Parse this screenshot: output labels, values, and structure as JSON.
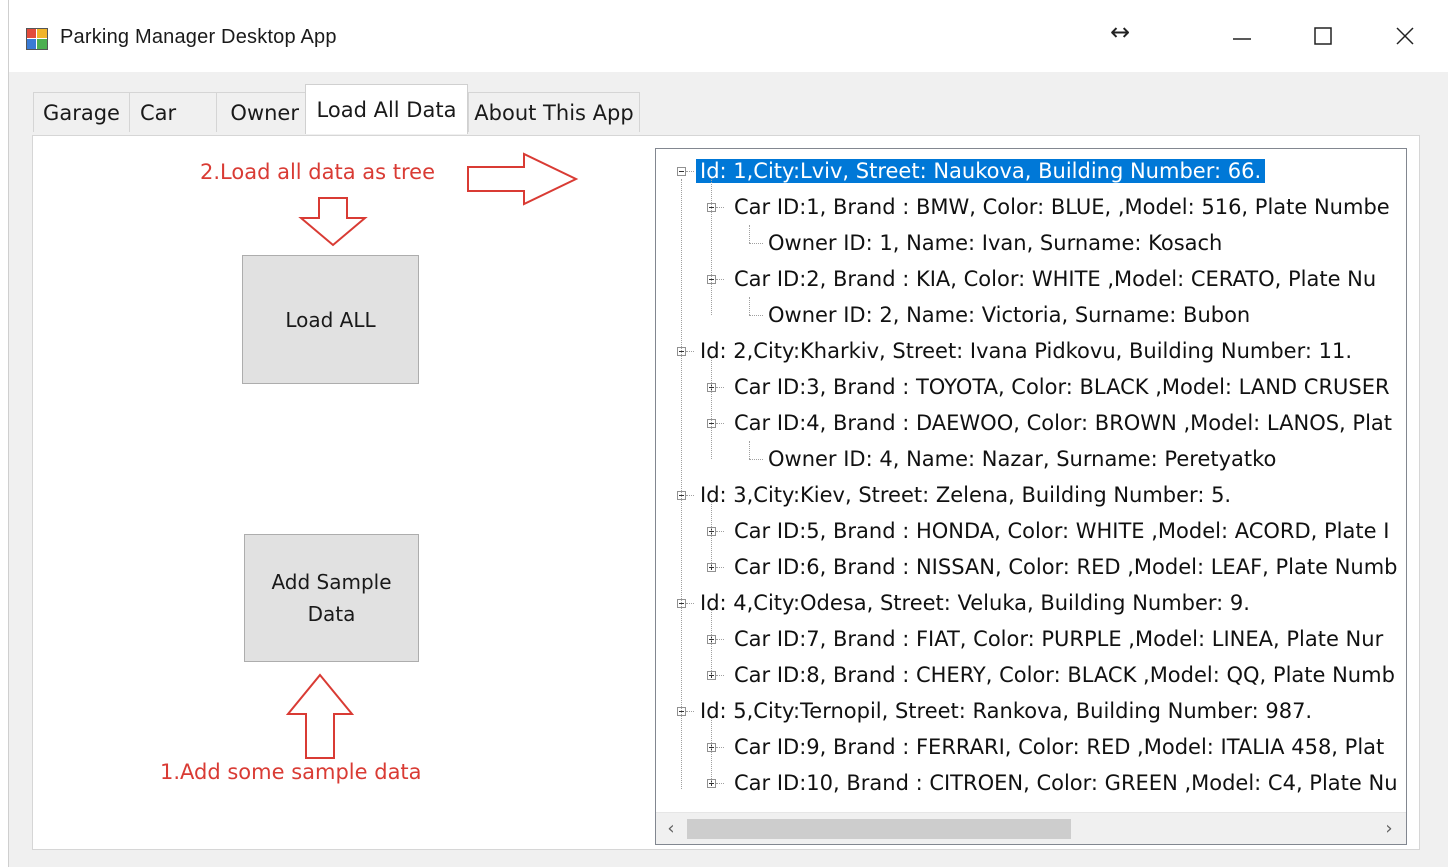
{
  "window": {
    "title": "Parking Manager Desktop App",
    "resize_glyph": "↔"
  },
  "tabs": [
    {
      "label": "Garage"
    },
    {
      "label": "Car"
    },
    {
      "label": "Owner"
    },
    {
      "label": "Load All Data"
    },
    {
      "label": "About This App"
    }
  ],
  "active_tab": "Load All Data",
  "annotations": {
    "step2": "2.Load all data as tree",
    "step1": "1.Add some sample data"
  },
  "buttons": {
    "load_all": "Load ALL",
    "add_sample_line1": "Add Sample",
    "add_sample_line2": "Data"
  },
  "tree": {
    "nodes": [
      {
        "text": "Id: 1,City:Lviv, Street: Naukova, Building Number: 66.",
        "level": 0,
        "expanded": true,
        "selected": true
      },
      {
        "text": "Car ID:1, Brand : BMW, Color: BLUE, ,Model: 516, Plate Numbe",
        "level": 1,
        "expanded": true
      },
      {
        "text": "Owner ID: 1, Name: Ivan, Surname: Kosach",
        "level": 2,
        "leaf": true
      },
      {
        "text": "Car ID:2, Brand : KIA, Color: WHITE ,Model: CERATO, Plate Nu",
        "level": 1,
        "expanded": true
      },
      {
        "text": "Owner ID: 2, Name: Victoria, Surname: Bubon",
        "level": 2,
        "leaf": true
      },
      {
        "text": "Id: 2,City:Kharkiv, Street: Ivana Pidkovu, Building Number: 11.",
        "level": 0,
        "expanded": true
      },
      {
        "text": "Car ID:3, Brand : TOYOTA, Color: BLACK ,Model: LAND CRUSER",
        "level": 1,
        "expanded": false
      },
      {
        "text": "Car ID:4, Brand : DAEWOO, Color: BROWN ,Model: LANOS, Plat",
        "level": 1,
        "expanded": true
      },
      {
        "text": "Owner ID: 4, Name: Nazar, Surname: Peretyatko",
        "level": 2,
        "leaf": true
      },
      {
        "text": "Id: 3,City:Kiev, Street: Zelena, Building Number: 5.",
        "level": 0,
        "expanded": true
      },
      {
        "text": "Car ID:5, Brand : HONDA, Color: WHITE ,Model: ACORD, Plate I",
        "level": 1,
        "expanded": false
      },
      {
        "text": "Car ID:6, Brand : NISSAN, Color: RED ,Model: LEAF, Plate Numb",
        "level": 1,
        "expanded": false
      },
      {
        "text": "Id: 4,City:Odesa, Street: Veluka, Building Number: 9.",
        "level": 0,
        "expanded": true
      },
      {
        "text": "Car ID:7, Brand : FIAT, Color: PURPLE ,Model: LINEA, Plate Nur",
        "level": 1,
        "expanded": false
      },
      {
        "text": "Car ID:8, Brand : CHERY, Color: BLACK ,Model: QQ, Plate Numb",
        "level": 1,
        "expanded": false
      },
      {
        "text": "Id: 5,City:Ternopil, Street: Rankova, Building Number: 987.",
        "level": 0,
        "expanded": true
      },
      {
        "text": "Car ID:9, Brand : FERRARI, Color: RED ,Model: ITALIA 458, Plat",
        "level": 1,
        "expanded": false
      },
      {
        "text": "Car ID:10, Brand : CITROEN, Color: GREEN ,Model: C4, Plate Nu",
        "level": 1,
        "expanded": false
      }
    ],
    "scroll_left_glyph": "‹",
    "scroll_right_glyph": "›"
  },
  "colors": {
    "annotation": "#d93b34",
    "selection": "#0078d7"
  },
  "icons": {
    "app": "app-window-icon",
    "resize": "horizontal-resize-icon",
    "minimize": "minimize-icon",
    "maximize": "maximize-icon",
    "close": "close-icon"
  }
}
